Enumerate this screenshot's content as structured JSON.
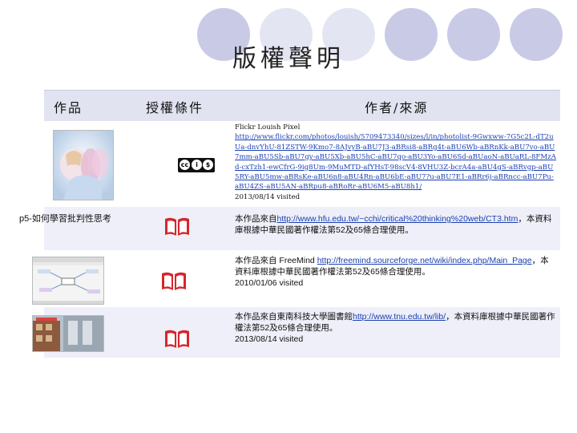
{
  "page": {
    "title": "版權聲明"
  },
  "table": {
    "headers": {
      "work": "作品",
      "license": "授權條件",
      "author": "作者/來源"
    }
  },
  "rows": [
    {
      "work_label": "",
      "source_name": "Flickr Louish Pixel",
      "url": "http://www.flickr.com/photos/louish/5709473340/sizes/l/in/photolist-9Gwxww-7G5c2L-dT2uUa-dnvYhU-81ZSTW-9Kmo7-8AJvyB-aBU7J3-aBRsi8-aBRg4t-aBU6Wb-aBRnKk-aBU7vo-aBU7mm-aBU5Sb-aBU7gy-aBU5Xb-aBU5hC-aBU7qo-aBU3Yo-aBU6Sd-aBUaoN-aBUaRL-8FMzAd-cxTzh1-ewCfrG-9ig8Um-9MuMTD-afYHsT-98scV4-8VHU3Z-bcrA4a-aBU4gS-aBRvgp-aBU5RY-aBU5mw-aBRsKe-aBU6n8-aBU4Rn-aBU6bE-aBU7?u-aBU7E1-aBRr6j-aBRncc-aBU7Pu-aBU4ZS-aBU5AN-aBRpu8-aBRoRr-aBU6M5-aBU8h1/",
      "visited": "2013/08/14 visited",
      "license_badge": "cc-by-nc-sa"
    },
    {
      "work_label": "p5-如何學習批判性思考",
      "text_before": "本作品來自",
      "url": "http://www.hfu.edu.tw/~cchi/critical%20thinking%20web/CT3.htm",
      "text_after": "，本資料庫根據中華民國著作權法第52及65條合理使用。"
    },
    {
      "work_label": "",
      "text_before": "本作品來自 FreeMind ",
      "url": "http://freemind.sourceforge.net/wiki/index.php/Main_Page",
      "text_after": "，本資料庫根據中華民國著作權法第52及65條合理使用。",
      "visited": "2010/01/06 visited"
    },
    {
      "work_label": "",
      "text_before": "本作品來自東南科技大學圖書館",
      "url": "http://www.tnu.edu.tw/lib/",
      "text_after": "，本資料庫根據中華民國著作權法第52及65條合理使用。",
      "visited": "2013/08/14 visited"
    }
  ]
}
